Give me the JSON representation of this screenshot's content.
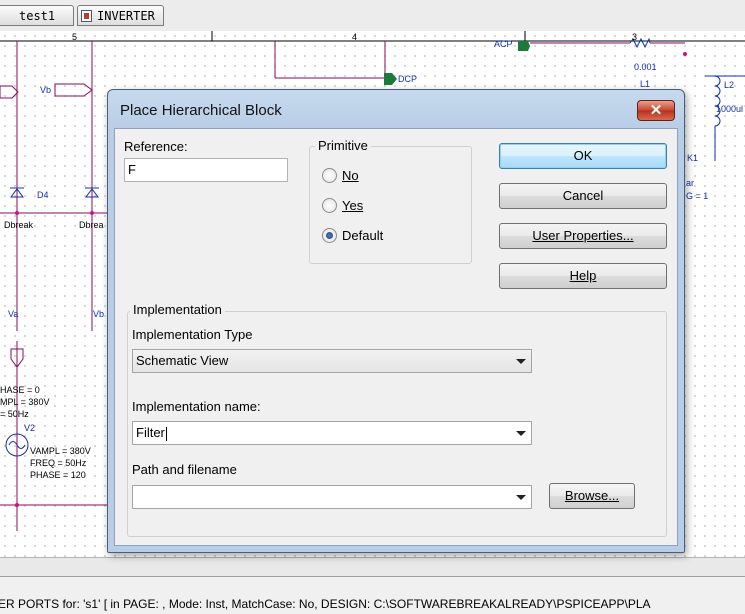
{
  "tabs": [
    {
      "label": "test1"
    },
    {
      "label": "INVERTER"
    }
  ],
  "schematic": {
    "ruler": [
      "5",
      "4",
      "3"
    ],
    "labels": {
      "acp": "ACP",
      "dcp": "DCP",
      "r_value": "0.001",
      "l1": "L1",
      "l2": "L2",
      "l2_value": "1000ul",
      "k1": "K1",
      "vb_top": "Vb",
      "d4": "D4",
      "dbreak1": "Dbreak",
      "dbreak2": "Dbrea",
      "va": "Va",
      "vb_mid": "Vb",
      "phase0": "HASE = 0",
      "vampl_left": "MPL = 380V",
      "freq_left": "= 50Hz",
      "v2": "V2",
      "vampl": "VAMPL = 380V",
      "freq": "FREQ = 50Hz",
      "phase120": "PHASE = 120",
      "ar": "ar",
      "g1": "G = 1"
    }
  },
  "dialog": {
    "title": "Place Hierarchical Block",
    "reference_label": "Reference:",
    "reference_value": "F",
    "primitive_label": "Primitive",
    "primitive_options": [
      "No",
      "Yes",
      "Default"
    ],
    "primitive_selected": "Default",
    "buttons": {
      "ok": "OK",
      "cancel": "Cancel",
      "user_properties": "User Properties...",
      "help": "Help"
    },
    "implementation": {
      "group_label": "Implementation",
      "type_label": "Implementation Type",
      "type_value": "Schematic View",
      "name_label": "Implementation name:",
      "name_value": "Filter",
      "path_label": "Path and filename",
      "path_value": "",
      "browse": "Browse..."
    }
  },
  "status": {
    "text": "ER PORTS for: 's1' [ in PAGE: , Mode: Inst, MatchCase: No, DESIGN: C:\\SOFTWAREBREAKALREADY\\PSPICEAPP\\PLA"
  },
  "colors": {
    "wire": "#8b0a5a",
    "part": "#1030b0",
    "net_flag": "#1c7a3c",
    "dialog_frame": "#b8cde6",
    "close_button": "#c8452e"
  }
}
